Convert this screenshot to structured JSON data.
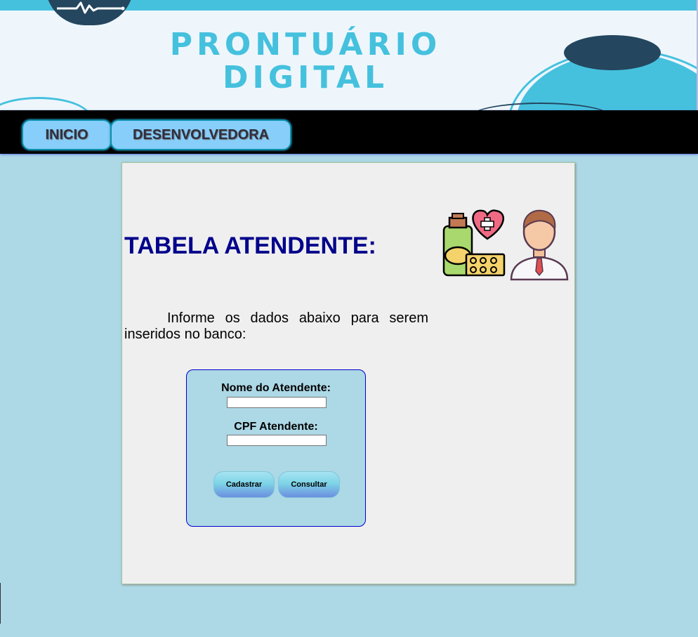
{
  "header": {
    "title_line1": "PRONTUÁRIO",
    "title_line2": "DIGITAL",
    "logo_icon": "heartbeat-icon"
  },
  "nav": {
    "items": [
      {
        "label": "INICIO"
      },
      {
        "label": "DESENVOLVEDORA"
      }
    ]
  },
  "main": {
    "title": "TABELA ATENDENTE:",
    "illustration": "doctor-medicine-icon",
    "intro": "Informe os dados abaixo para serem inseridos no banco:",
    "form": {
      "fields": [
        {
          "label": "Nome do Atendente:",
          "value": ""
        },
        {
          "label": "CPF Atendente:",
          "value": ""
        }
      ],
      "buttons": {
        "submit": "Cadastrar",
        "query": "Consultar"
      }
    }
  },
  "colors": {
    "page_bg": "#ADD8E6",
    "title": "#00008B",
    "banner_accent": "#45C1DE",
    "banner_dark": "#24465E",
    "nav_bg": "#000000",
    "nav_button": "#87CEFA",
    "card_bg": "#EFEFEF",
    "form_border": "#0000CD"
  }
}
